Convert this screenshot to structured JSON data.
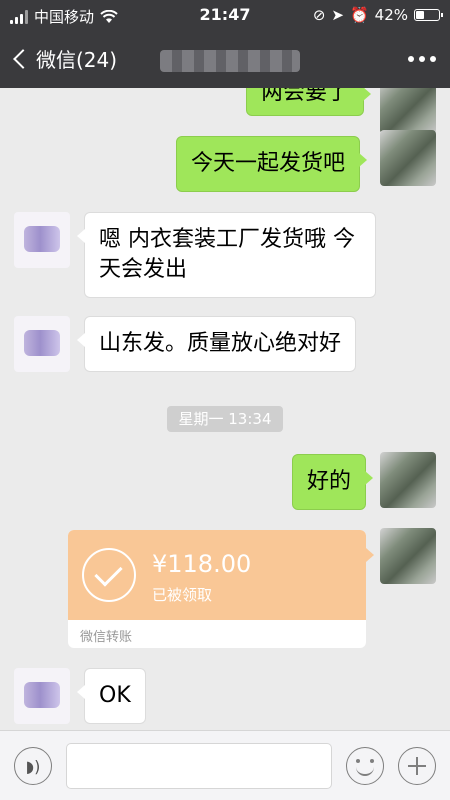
{
  "status_bar": {
    "carrier": "中国移动",
    "time": "21:47",
    "battery": "42%",
    "battery_level": 0.42
  },
  "nav": {
    "back_label": "微信(24)"
  },
  "messages": [
    {
      "side": "me",
      "text": "两会要了"
    },
    {
      "side": "me",
      "text": "今天一起发货吧"
    },
    {
      "side": "other",
      "text": "嗯 内衣套装工厂发货哦 今天会发出"
    },
    {
      "side": "other",
      "text": "山东发。质量放心绝对好"
    },
    {
      "side": "me",
      "text": "好的"
    },
    {
      "side": "other",
      "text": "OK"
    }
  ],
  "timestamp": "星期一 13:34",
  "transfer": {
    "amount": "¥118.00",
    "status": "已被领取",
    "label": "微信转账"
  },
  "input": {
    "placeholder": ""
  }
}
